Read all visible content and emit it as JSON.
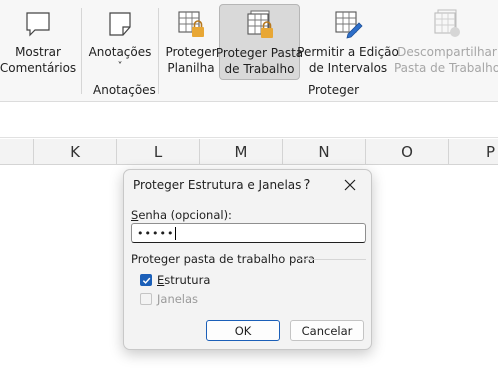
{
  "ribbon": {
    "buttons": [
      {
        "label": "Mostrar\nComentários",
        "icon": "comment-icon"
      },
      {
        "label": "Anotações",
        "icon": "note-icon",
        "chevron": "˅"
      },
      {
        "label": "Proteger\nPlanilha",
        "icon": "protect-sheet-icon"
      },
      {
        "label": "Proteger Pasta\nde Trabalho",
        "icon": "protect-workbook-icon"
      },
      {
        "label": "Permitir a Edição\nde Intervalos",
        "icon": "allow-edit-ranges-icon"
      },
      {
        "label": "Descompartilhar\nPasta de Trabalho",
        "icon": "unshare-workbook-icon"
      }
    ],
    "groups": {
      "notes": "Anotações",
      "protect": "Proteger"
    }
  },
  "columns": [
    "K",
    "L",
    "M",
    "N",
    "O",
    "P"
  ],
  "dialog": {
    "title": "Proteger Estrutura e Janelas",
    "help": "?",
    "close_icon": "close-icon",
    "password_label_first": "S",
    "password_label_rest": "enha (opcional):",
    "password_value": "•••••",
    "section_label": "Proteger pasta de trabalho para",
    "structure_first": "E",
    "structure_rest": "strutura",
    "structure_checked": true,
    "windows_label": "Janelas",
    "windows_checked": false,
    "ok_label": "OK",
    "cancel_label": "Cancelar"
  },
  "colors": {
    "accent": "#1b5fb8",
    "ribbon_bg": "#f7f7f7",
    "lock": "#e8a735"
  }
}
